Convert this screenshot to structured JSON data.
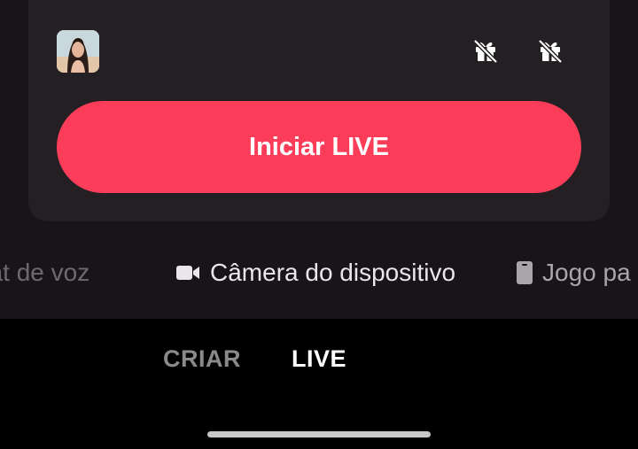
{
  "card": {
    "avatar_alt": "avatar",
    "start_button_label": "Iniciar LIVE",
    "icons": [
      "gift-off-icon",
      "gift-off-icon"
    ]
  },
  "modes": [
    {
      "label": "hat de voz",
      "icon": "microphone-icon"
    },
    {
      "label": "Câmera do dispositivo",
      "icon": "video-camera-icon"
    },
    {
      "label": "Jogo pa",
      "icon": "phone-icon"
    }
  ],
  "tabs": {
    "criar": "CRIAR",
    "live": "LIVE",
    "active": "LIVE"
  },
  "colors": {
    "accent": "#fb3d5a",
    "background": "#181418",
    "card": "#231f23",
    "bottom_bar": "#000000"
  }
}
